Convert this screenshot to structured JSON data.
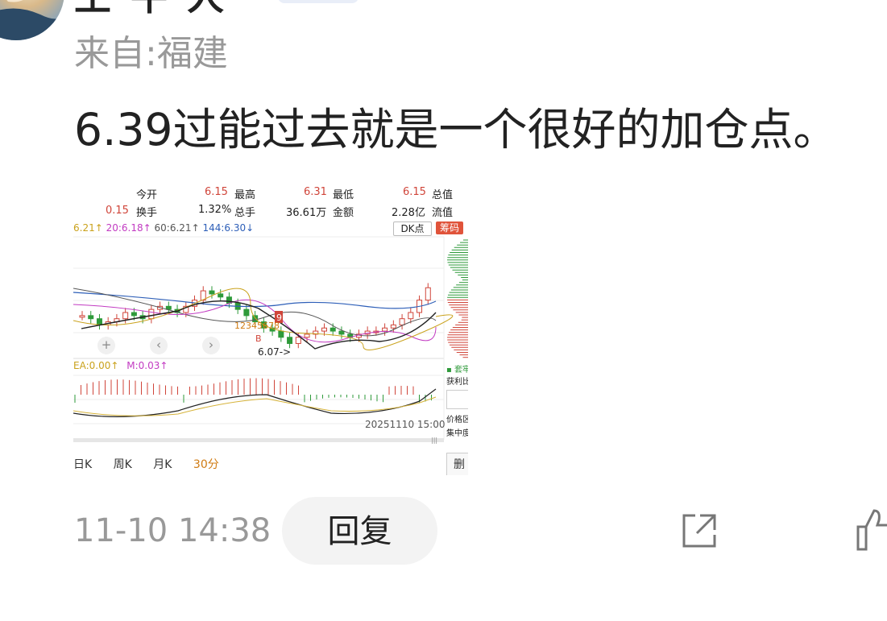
{
  "user": {
    "name_fragment": "王 牛 人",
    "location": "来自:福建"
  },
  "comment": {
    "text": "6.39过能过去就是一个很好的加仓点。"
  },
  "stock_info": {
    "row1": [
      {
        "label": "今开",
        "value": "6.15",
        "label2": "最高",
        "value2": "6.31",
        "label3": "最低",
        "value3": "6.15",
        "label4": "总值"
      }
    ],
    "open_label": "今开",
    "open_value": "6.15",
    "high_label": "最高",
    "high_value": "6.31",
    "low_label": "最低",
    "low_value": "6.15",
    "mcap_label": "总值",
    "change_value": "0.15",
    "turnover_label": "换手",
    "turnover_value": "1.32%",
    "volume_label": "总手",
    "volume_value": "36.61万",
    "amount_label": "金额",
    "amount_value": "2.28亿",
    "float_label": "流值"
  },
  "ma_legend": {
    "ma5": "6.21↑",
    "ma20": "20:6.18↑",
    "ma60": "60:6.21↑",
    "ma144": "144:6.30↓"
  },
  "chart_controls": {
    "dk_label": "DK点",
    "chips_label": "筹码",
    "marker_9": "9",
    "low_annotation": "6.07->",
    "seq_label": "12345678",
    "b_marker": "B",
    "side_stuck": "▪ 套牢",
    "side_profit": "获利比",
    "side_price": "价格区",
    "side_conc": "集中度"
  },
  "macd_legend": {
    "ea": "EA:0.00↑",
    "m": "M:0.03↑"
  },
  "chart_timestamp": "20251110 15:00",
  "period_tabs": [
    "日K",
    "周K",
    "月K",
    "30分"
  ],
  "period_active": "30分",
  "side_button": "删",
  "footer": {
    "timestamp": "11-10 14:38",
    "reply": "回复"
  },
  "colors": {
    "up": "#d0453a",
    "down": "#2e9a3a",
    "ma144": "#2e5fb8",
    "accent": "#d07b12"
  },
  "chart_data": {
    "type": "candlestick",
    "series": [
      {
        "name": "price",
        "values": [
          6.17,
          6.16,
          6.14,
          6.15,
          6.16,
          6.18,
          6.17,
          6.16,
          6.19,
          6.2,
          6.19,
          6.18,
          6.2,
          6.22,
          6.25,
          6.24,
          6.23,
          6.21,
          6.19,
          6.17,
          6.15,
          6.13,
          6.12,
          6.1,
          6.08,
          6.1,
          6.11,
          6.12,
          6.13,
          6.12,
          6.11,
          6.1,
          6.11,
          6.12,
          6.12,
          6.13,
          6.14,
          6.16,
          6.18,
          6.22,
          6.26
        ]
      }
    ]
  }
}
